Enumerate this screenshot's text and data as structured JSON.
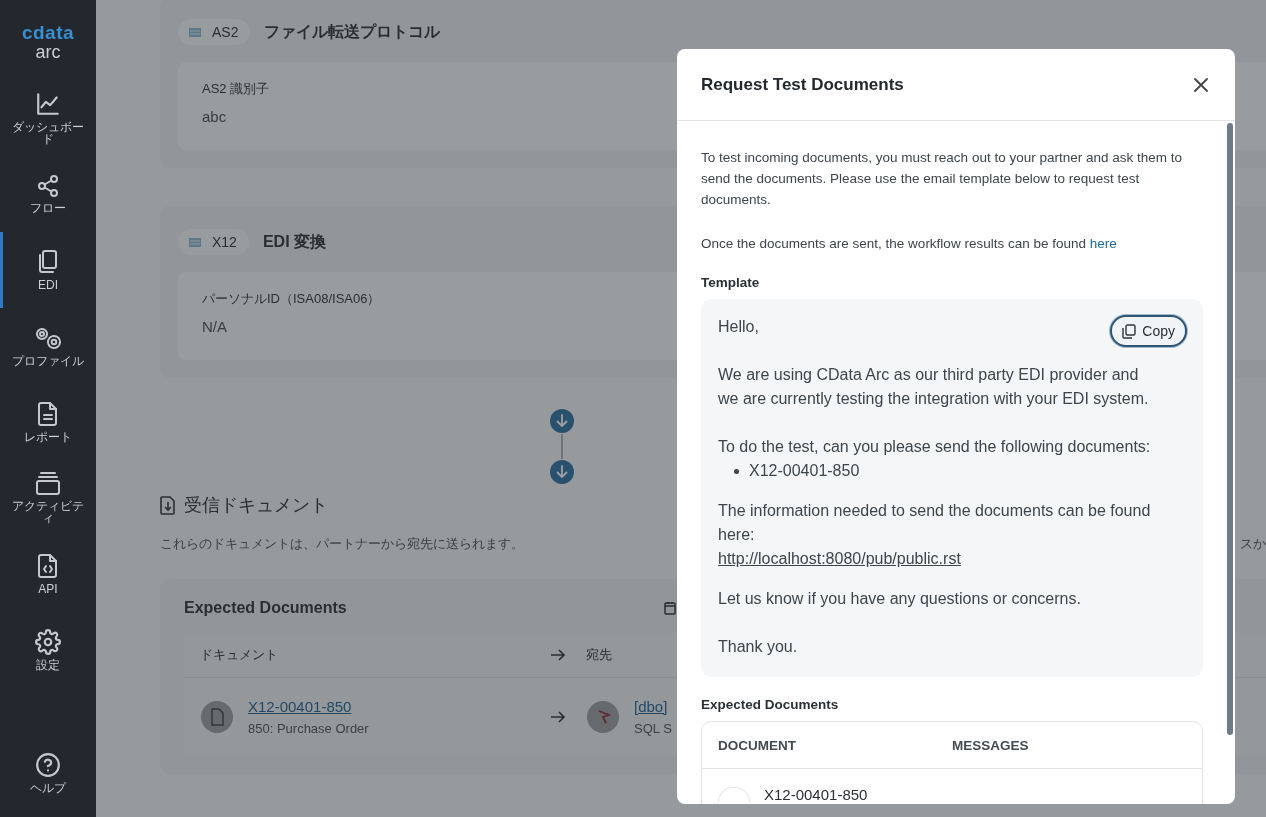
{
  "sidebar": {
    "logo": {
      "brand": "cdata",
      "product": "arc"
    },
    "items": [
      {
        "label": "ダッシュボード",
        "kind": "chart",
        "selected": false
      },
      {
        "label": "フロー",
        "kind": "flow",
        "selected": false
      },
      {
        "label": "EDI",
        "kind": "docs",
        "selected": true
      },
      {
        "label": "プロファイル",
        "kind": "gears",
        "selected": false
      },
      {
        "label": "レポート",
        "kind": "report",
        "selected": false
      },
      {
        "label": "アクティビティ",
        "kind": "activity",
        "selected": false
      },
      {
        "label": "API",
        "kind": "api",
        "selected": false
      },
      {
        "label": "設定",
        "kind": "settings",
        "selected": false
      },
      {
        "label": "ヘルプ",
        "kind": "help",
        "selected": false
      }
    ]
  },
  "sections": [
    {
      "badge": "AS2",
      "title": "ファイル転送プロトコル",
      "field": {
        "label": "AS2 識別子",
        "value": "abc"
      }
    },
    {
      "badge": "X12",
      "title": "EDI 変換",
      "field": {
        "label": "パーソナルID（ISA08/ISA06）",
        "value": "N/A"
      }
    }
  ],
  "incoming": {
    "title": "受信ドキュメント",
    "description": "これらのドキュメントは、パートナーから宛先に送られます。",
    "description_tail": "スか",
    "table": {
      "title": "Expected Documents",
      "columns": [
        "ドキュメント",
        "宛先"
      ],
      "rows": [
        {
          "document": "X12-00401-850",
          "document_type": "850: Purchase Order",
          "destination": "[dbo]",
          "destination_type": "SQL S"
        }
      ]
    }
  },
  "modal": {
    "title": "Request Test Documents",
    "intro": "To test incoming documents, you must reach out to your partner and ask them to send the documents. Please use the email template below to request test documents.",
    "results_text": "Once the documents are sent, the workflow results can be found",
    "results_link": "here",
    "template_label": "Template",
    "copy_button": "Copy",
    "template": [
      {
        "kind": "text",
        "text": "Hello,"
      },
      {
        "kind": "text",
        "text": "We are using CData Arc as our third party EDI provider and we are currently testing the integration with your EDI system."
      },
      {
        "kind": "text",
        "text": "To do the test, can you please send the following documents:"
      },
      {
        "kind": "list",
        "items": [
          "X12-00401-850"
        ]
      },
      {
        "kind": "text",
        "text": "The information needed to send the documents can be found here:"
      },
      {
        "kind": "link",
        "text": "http://localhost:8080/pub/public.rst"
      },
      {
        "kind": "text",
        "text": "Let us know if you have any questions or concerns."
      },
      {
        "kind": "text",
        "text": "Thank you."
      }
    ],
    "expected_label": "Expected Documents",
    "columns": [
      "DOCUMENT",
      "MESSAGES"
    ],
    "rows": [
      {
        "document": "X12-00401-850"
      }
    ]
  }
}
